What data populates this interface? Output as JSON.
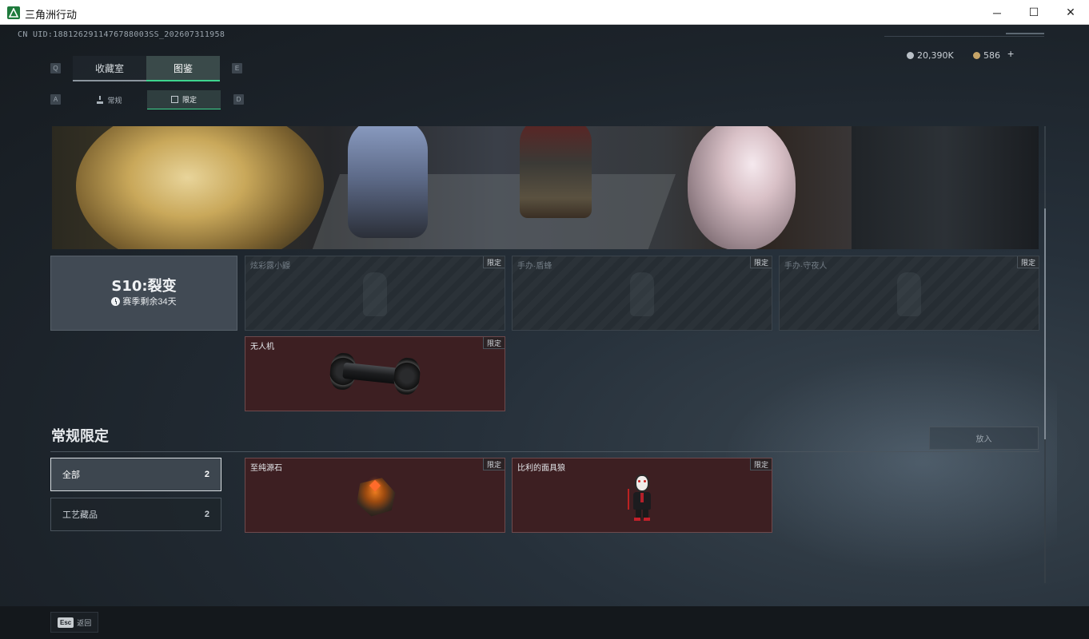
{
  "window": {
    "title": "三角洲行动",
    "minimize_glyph": "─",
    "maximize_glyph": "☐",
    "close_glyph": "✕"
  },
  "header": {
    "uid": "CN UID:1881262911476788003SS_202607311958",
    "currency1": "20,390K",
    "currency2": "586",
    "add_glyph": "+"
  },
  "tabs": {
    "prev_key": "Q",
    "next_key": "E",
    "items": [
      {
        "label": "收藏室",
        "active": false
      },
      {
        "label": "图鉴",
        "active": true
      }
    ]
  },
  "subtabs": {
    "prev_key": "A",
    "next_key": "D",
    "items": [
      {
        "label": "常规",
        "icon": "flask-icon",
        "active": false
      },
      {
        "label": "限定",
        "icon": "picture-icon",
        "active": true
      }
    ]
  },
  "season": {
    "name": "S10:裂变",
    "remaining": "赛季剩余34天"
  },
  "limited_cards": [
    {
      "name": "炫彩露小鼹",
      "badge": "限定",
      "owned": false
    },
    {
      "name": "手办·盾蜂",
      "badge": "限定",
      "owned": false
    },
    {
      "name": "手办·守夜人",
      "badge": "限定",
      "owned": false
    },
    {
      "name": "无人机",
      "badge": "限定",
      "owned": true,
      "art": "drone-item"
    }
  ],
  "regular_section": {
    "title": "常规限定",
    "put_button": "放入",
    "filters": [
      {
        "label": "全部",
        "count": "2",
        "selected": true
      },
      {
        "label": "工艺藏品",
        "count": "2",
        "selected": false
      }
    ],
    "cards": [
      {
        "name": "至纯源石",
        "badge": "限定",
        "owned": true,
        "art": "gem-item"
      },
      {
        "name": "比利的面具狼",
        "badge": "限定",
        "owned": true,
        "art": "puppet-item"
      }
    ]
  },
  "footer": {
    "esc_key": "Esc",
    "back_label": "返回"
  },
  "colors": {
    "accent_green": "#3ed58e",
    "owned_card_bg": "#3d1f22",
    "panel_bg": "#1c232a"
  }
}
